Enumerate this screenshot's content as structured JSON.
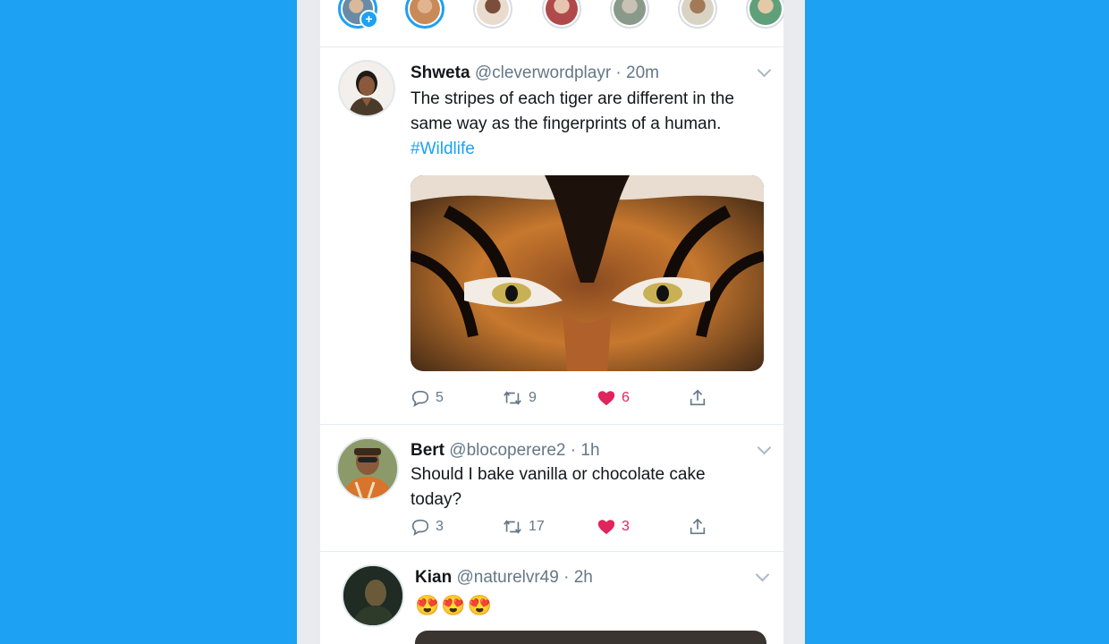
{
  "fleets": [
    {
      "name": "your-fleet",
      "active": true,
      "add": true,
      "color": "#6a8aa6"
    },
    {
      "name": "fleet-2",
      "active": true,
      "color": "#c98a5a"
    },
    {
      "name": "fleet-3",
      "active": false,
      "color": "#8a5a48"
    },
    {
      "name": "fleet-4",
      "active": false,
      "color": "#b04a4a"
    },
    {
      "name": "fleet-5",
      "active": false,
      "color": "#8a9a8a"
    },
    {
      "name": "fleet-6",
      "active": false,
      "color": "#a27a58"
    },
    {
      "name": "fleet-7",
      "active": false,
      "color": "#5fa07a"
    }
  ],
  "tweets": [
    {
      "name": "Shweta",
      "handle": "@cleverwordplayr",
      "time": "20m",
      "text": "The stripes of each tiger are different in the same way as the fingerprints of a human.",
      "hashtag": "#Wildlife",
      "replies": "5",
      "retweets": "9",
      "likes": "6"
    },
    {
      "name": "Bert",
      "handle": "@blocoperere2",
      "time": "1h",
      "text": "Should I bake vanilla or chocolate cake today?",
      "replies": "3",
      "retweets": "17",
      "likes": "3"
    },
    {
      "name": "Kian",
      "handle": "@naturelvr49",
      "time": "2h",
      "text": "😍😍😍"
    }
  ],
  "separator": " · ",
  "colors": {
    "accent": "#1da1f2",
    "like": "#e0245e",
    "muted": "#657786"
  }
}
